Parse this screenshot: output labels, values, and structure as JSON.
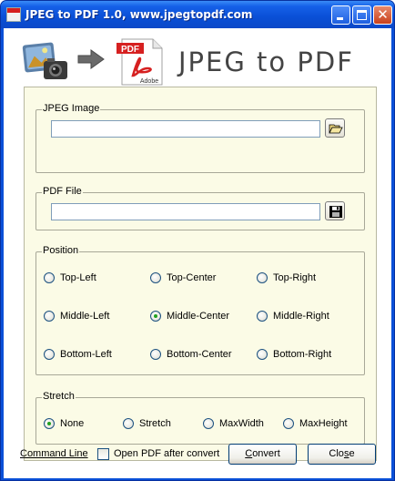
{
  "window": {
    "title": "JPEG to PDF 1.0, www.jpegtopdf.com"
  },
  "banner": {
    "title": "JPEG to PDF",
    "pdf_badge": "PDF",
    "adobe_text": "Adobe",
    "icons": [
      "camera-photo-icon",
      "arrow-right-icon",
      "adobe-pdf-icon"
    ]
  },
  "jpeg_group": {
    "legend": "JPEG Image",
    "value": "",
    "browse_icon": "folder-open-icon"
  },
  "pdf_group": {
    "legend": "PDF File",
    "value": "",
    "save_icon": "floppy-disk-icon"
  },
  "position_group": {
    "legend": "Position",
    "options": [
      {
        "label": "Top-Left",
        "selected": false
      },
      {
        "label": "Top-Center",
        "selected": false
      },
      {
        "label": "Top-Right",
        "selected": false
      },
      {
        "label": "Middle-Left",
        "selected": false
      },
      {
        "label": "Middle-Center",
        "selected": true
      },
      {
        "label": "Middle-Right",
        "selected": false
      },
      {
        "label": "Bottom-Left",
        "selected": false
      },
      {
        "label": "Bottom-Center",
        "selected": false
      },
      {
        "label": "Bottom-Right",
        "selected": false
      }
    ]
  },
  "stretch_group": {
    "legend": "Stretch",
    "options": [
      {
        "label": "None",
        "selected": true
      },
      {
        "label": "Stretch",
        "selected": false
      },
      {
        "label": "MaxWidth",
        "selected": false
      },
      {
        "label": "MaxHeight",
        "selected": false
      }
    ]
  },
  "footer": {
    "command_line": "Command Line",
    "open_after_convert": "Open PDF after convert",
    "open_after_convert_checked": false,
    "convert_first": "C",
    "convert_rest": "onvert",
    "close_pre": "Clo",
    "close_ul": "s",
    "close_post": "e"
  },
  "colors": {
    "titlebar": "#0a4fd6",
    "panel": "#fbfbe6",
    "radio_selected": "#21a121",
    "pdf_red": "#d62020"
  }
}
